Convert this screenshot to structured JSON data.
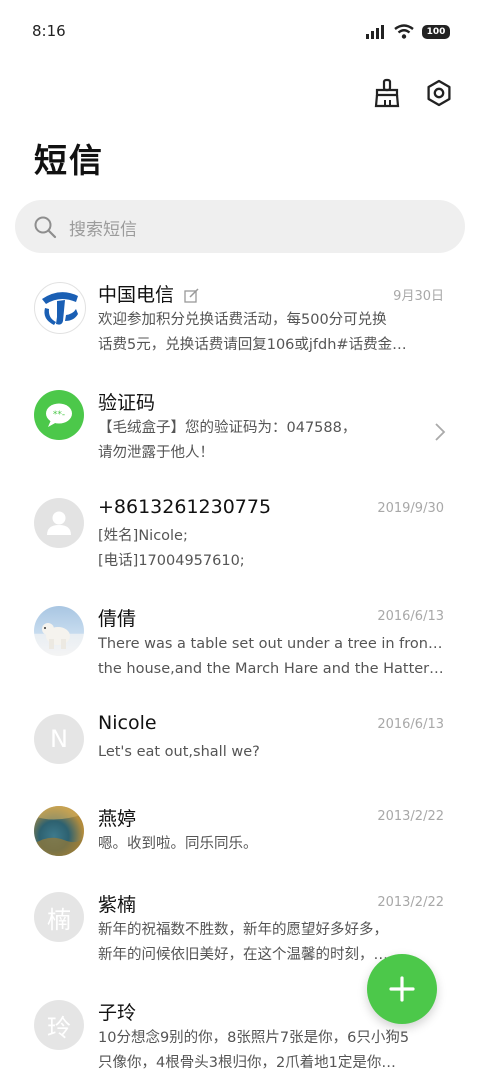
{
  "status": {
    "time": "8:16",
    "battery": "100"
  },
  "header": {
    "title": "短信"
  },
  "search": {
    "placeholder": "搜索短信"
  },
  "messages": [
    {
      "name": "中国电信",
      "date": "9月30日",
      "line1": "欢迎参加积分兑换话费活动，每500分可兑换",
      "line2": "话费5元，兑换话费请回复106或jfdh#话费金…",
      "avatar": "telecom-logo"
    },
    {
      "name": "验证码",
      "date": "",
      "line1": "【毛绒盒子】您的验证码为：047588，",
      "line2": "请勿泄露于他人！",
      "avatar": "sms-bubble"
    },
    {
      "name": "+8613261230775",
      "date": "2019/9/30",
      "line1": "[姓名]Nicole;",
      "line2": "[电话]17004957610;",
      "avatar": "person"
    },
    {
      "name": "倩倩",
      "date": "2016/6/13",
      "line1": "There was a table set out under a tree in front of",
      "line2": "the house,and the March Hare and the Hatter wer…",
      "avatar": "polar-bear-photo"
    },
    {
      "name": "Nicole",
      "date": "2016/6/13",
      "line1": "Let's eat out,shall we?",
      "line2": "",
      "avatar_letter": "N"
    },
    {
      "name": "燕婷",
      "date": "2013/2/22",
      "line1": "嗯。收到啦。同乐同乐。",
      "line2": "",
      "avatar": "landscape-photo"
    },
    {
      "name": "紫楠",
      "date": "2013/2/22",
      "line1": "新年的祝福数不胜数，新年的愿望好多好多，",
      "line2": "新年的问候依旧美好，在这个温馨的时刻，…",
      "avatar_letter": "楠"
    },
    {
      "name": "子玲",
      "date": "",
      "line1": "10分想念9别的你，8张照片7张是你，6只小狗5",
      "line2": "只像你，4根骨头3根归你，2爪着地1定是你…",
      "avatar_letter": "玲"
    }
  ],
  "colors": {
    "fab": "#4cc84a",
    "telecom_blue": "#1a5fb4",
    "sms_green": "#4cc84a"
  },
  "fab": {
    "icon": "plus-icon"
  }
}
